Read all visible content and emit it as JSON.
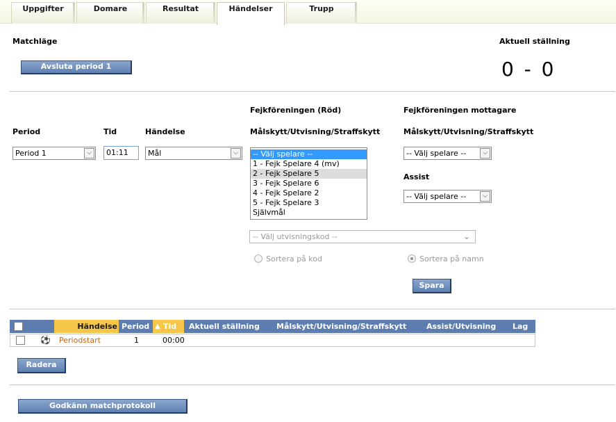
{
  "tabs": [
    {
      "label": "Uppgifter",
      "active": false
    },
    {
      "label": "Domare",
      "active": false
    },
    {
      "label": "Resultat",
      "active": false
    },
    {
      "label": "Händelser",
      "active": true
    },
    {
      "label": "Trupp",
      "active": false
    }
  ],
  "matchlage": {
    "title": "Matchläge",
    "end_period_label": "Avsluta period 1"
  },
  "score": {
    "title": "Aktuell ställning",
    "home": "0",
    "separator": "-",
    "away": "0"
  },
  "form": {
    "team_home_header": "Fejkföreningen (Röd)",
    "team_away_header": "Fejkföreningen mottagare",
    "period_label": "Period",
    "time_label": "Tid",
    "event_label": "Händelse",
    "scorer_label_home": "Målskytt/Utvisning/Straffskytt",
    "scorer_label_away": "Målskytt/Utvisning/Straffskytt",
    "assist_label": "Assist",
    "period_value": "Period 1",
    "time_value": "01:11",
    "event_value": "Mål",
    "player_options": [
      "-- Välj spelare --",
      "1 - Fejk Spelare 4 (mv)",
      "2 - Fejk Spelare 5",
      "3 - Fejk Spelare 6",
      "4 - Fejk Spelare 2",
      "5 - Fejk Spelare 3",
      "Självmål"
    ],
    "away_player_value": "-- Välj spelare --",
    "assist_value": "-- Välj spelare --",
    "penalty_code_placeholder": "-- Välj utvisningskod --",
    "sort_by_code_label": "Sortera på kod",
    "sort_by_name_label": "Sortera på namn",
    "sort_selected": "name",
    "save_label": "Spara"
  },
  "table": {
    "headers": {
      "event": "Händelse",
      "period": "Period",
      "time": "Tid",
      "score": "Aktuell ställning",
      "scorer": "Målskytt/Utvisning/Straffskytt",
      "assist": "Assist/Utvisning",
      "team": "Lag"
    },
    "sort_icon": "warning-triangle-icon",
    "rows": [
      {
        "icon": "ball-icon",
        "event": "Periodstart",
        "period": "1",
        "time": "00:00"
      }
    ],
    "delete_label": "Radera"
  },
  "footer": {
    "approve_label": "Godkänn matchprotokoll"
  },
  "colors": {
    "button_blue": "#6583b5",
    "header_blue": "#5d7db1",
    "header_orange": "#f5c64a",
    "link_orange": "#c7650f",
    "selected_option": "#3399ff"
  }
}
